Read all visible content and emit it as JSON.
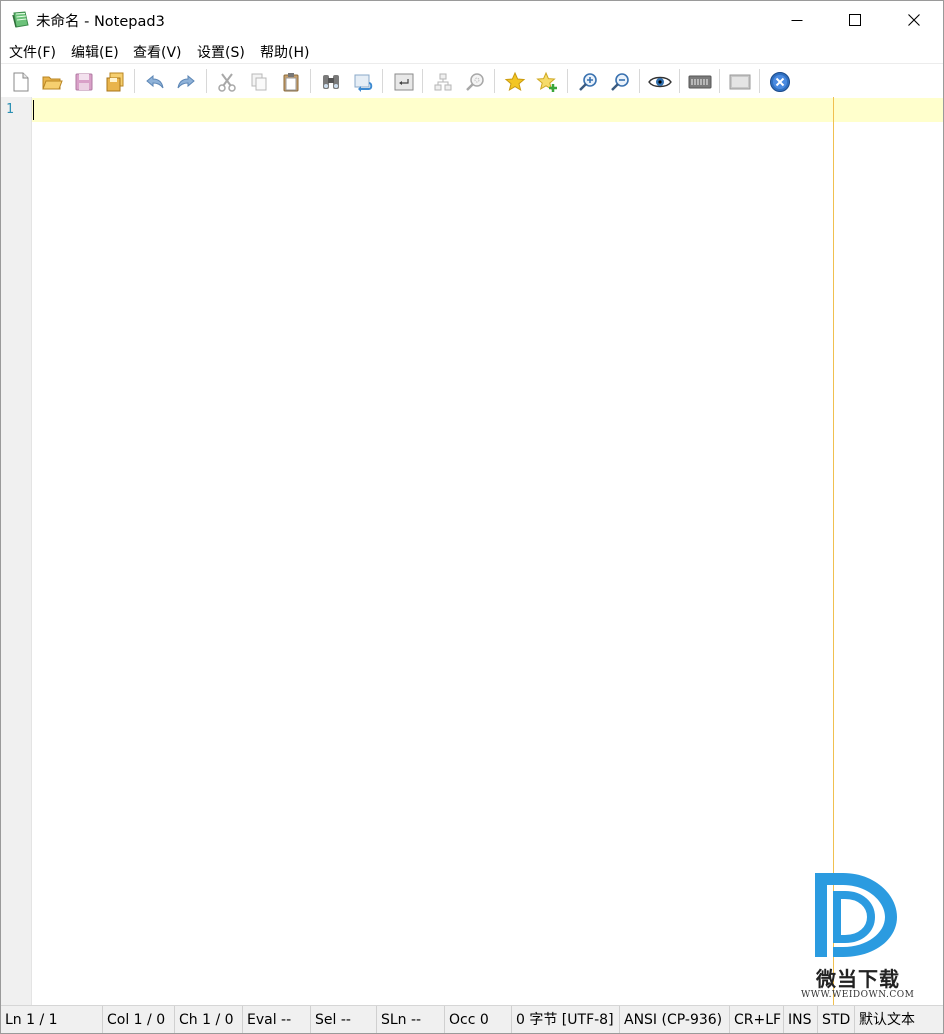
{
  "window": {
    "title": "未命名 - Notepad3"
  },
  "menu": [
    {
      "label": "文件(F)"
    },
    {
      "label": "编辑(E)"
    },
    {
      "label": "查看(V)"
    },
    {
      "label": "设置(S)"
    },
    {
      "label": "帮助(H)"
    }
  ],
  "toolbar": [
    {
      "name": "new-file-icon"
    },
    {
      "name": "open-folder-icon"
    },
    {
      "name": "save-icon"
    },
    {
      "name": "save-as-icon"
    },
    {
      "name": "undo-icon"
    },
    {
      "name": "redo-icon"
    },
    {
      "name": "cut-icon"
    },
    {
      "name": "copy-icon"
    },
    {
      "name": "paste-icon"
    },
    {
      "name": "find-icon"
    },
    {
      "name": "replace-icon"
    },
    {
      "name": "word-wrap-icon"
    },
    {
      "name": "fold-icon"
    },
    {
      "name": "mark-occurrences-icon"
    },
    {
      "name": "favorites-icon"
    },
    {
      "name": "add-favorite-icon"
    },
    {
      "name": "zoom-in-icon"
    },
    {
      "name": "zoom-out-icon"
    },
    {
      "name": "view-icon"
    },
    {
      "name": "keyboard-icon"
    },
    {
      "name": "screen-icon"
    },
    {
      "name": "exit-icon"
    }
  ],
  "editor": {
    "line_numbers": [
      "1"
    ]
  },
  "watermark": {
    "text": "微当下载",
    "url": "WWW.WEIDOWN.COM"
  },
  "status": {
    "ln": "Ln  1 / 1",
    "col": "Col  1 / 0",
    "ch": "Ch  1 / 0",
    "eval": "Eval  --",
    "sel": "Sel  --",
    "sln": "SLn  --",
    "occ": "Occ  0",
    "bytes": "0 字节 [UTF-8]",
    "encoding": "ANSI (CP-936)",
    "eol": "CR+LF",
    "ins": "INS",
    "std": "STD",
    "scheme": "默认文本"
  },
  "colors": {
    "current_line": "#ffffcc",
    "long_line_marker": "#f0c050",
    "line_number": "#2a8fb3",
    "watermark_blue": "#2b9be0"
  }
}
